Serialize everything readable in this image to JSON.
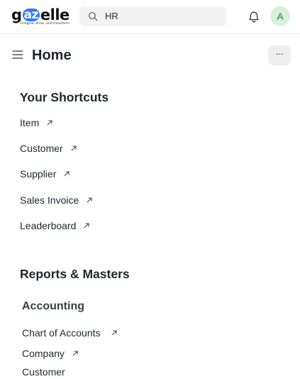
{
  "brand": {
    "logo_left": "g",
    "logo_az": "az",
    "logo_right": "elle",
    "tagline": "Imagine, drive, and transform"
  },
  "header": {
    "search_value": "HR",
    "avatar_initial": "A"
  },
  "page": {
    "title": "Home",
    "more_label": "···"
  },
  "shortcuts": {
    "title": "Your Shortcuts",
    "items": [
      {
        "label": "Item"
      },
      {
        "label": "Customer"
      },
      {
        "label": "Supplier"
      },
      {
        "label": "Sales Invoice"
      },
      {
        "label": "Leaderboard"
      }
    ]
  },
  "reports": {
    "title": "Reports & Masters",
    "groups": [
      {
        "title": "Accounting",
        "items": [
          {
            "label": "Chart of Accounts"
          },
          {
            "label": "Company"
          },
          {
            "label": "Customer"
          }
        ]
      }
    ]
  },
  "colors": {
    "accent": "#2f7cf6",
    "avatar_bg": "#d8f0dc",
    "avatar_fg": "#2f7d3b"
  }
}
